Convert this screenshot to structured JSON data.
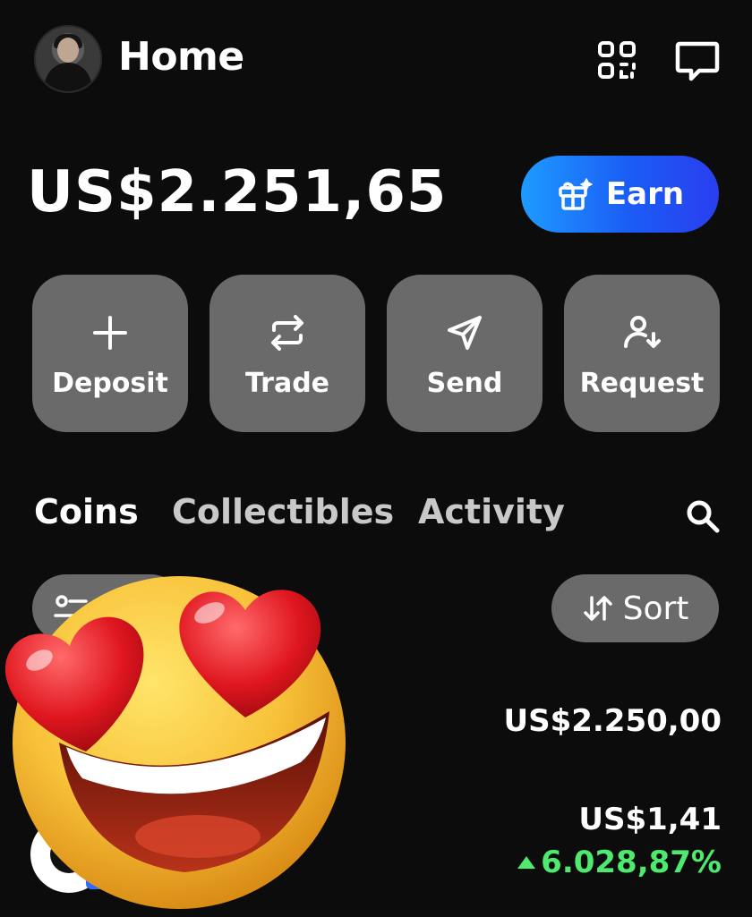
{
  "header": {
    "title": "Home",
    "avatar_icon": "user-avatar",
    "scan_icon": "qr-scan-icon",
    "chat_icon": "message-icon"
  },
  "balance": {
    "amount": "US$2.251,65",
    "earn_label": "Earn",
    "earn_gradient": [
      "#1e9bff",
      "#2a3ef0"
    ]
  },
  "actions": [
    {
      "label": "Deposit",
      "icon": "plus-icon"
    },
    {
      "label": "Trade",
      "icon": "swap-icon"
    },
    {
      "label": "Send",
      "icon": "send-icon"
    },
    {
      "label": "Request",
      "icon": "request-icon"
    }
  ],
  "tabs": [
    {
      "label": "Coins",
      "active": true
    },
    {
      "label": "Collectibles",
      "active": false
    },
    {
      "label": "Activity",
      "active": false
    }
  ],
  "controls": {
    "sort_label": "Sort"
  },
  "holdings": [
    {
      "value": "US$2.250,00"
    },
    {
      "value": "US$1,41",
      "change": "6.028,87%",
      "change_color": "#4ee96f"
    }
  ],
  "overlay": {
    "icon": "heart-eyes-emoji"
  }
}
